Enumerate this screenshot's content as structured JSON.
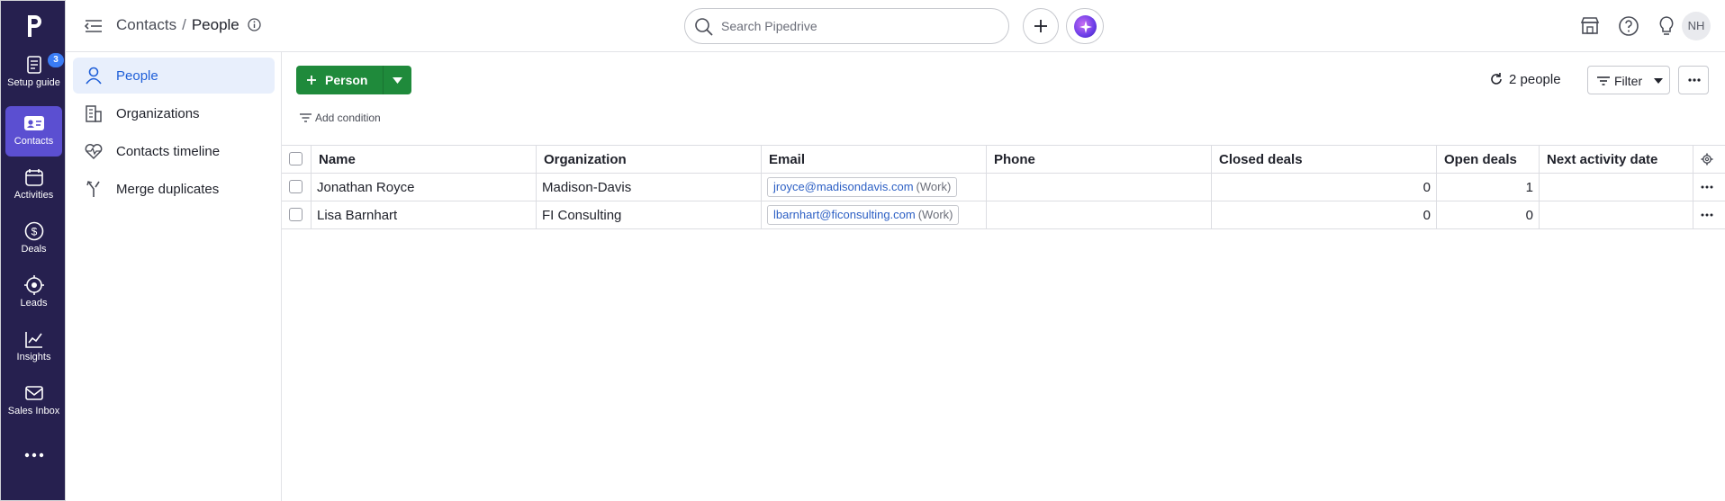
{
  "rail": {
    "logo": "P",
    "items": [
      {
        "label": "Setup guide",
        "icon": "checklist-icon",
        "badge": "3"
      },
      {
        "label": "Contacts",
        "icon": "contacts-card-icon"
      },
      {
        "label": "Activities",
        "icon": "calendar-icon"
      },
      {
        "label": "Deals",
        "icon": "dollar-icon"
      },
      {
        "label": "Leads",
        "icon": "target-icon"
      },
      {
        "label": "Insights",
        "icon": "chart-icon"
      },
      {
        "label": "Sales Inbox",
        "icon": "mail-icon"
      }
    ],
    "more": "more-icon"
  },
  "header": {
    "breadcrumb_parent": "Contacts",
    "breadcrumb_sep": "/",
    "breadcrumb_current": "People",
    "search_placeholder": "Search Pipedrive",
    "avatar_initials": "NH"
  },
  "sidenav": {
    "items": [
      {
        "label": "People",
        "icon": "person-icon",
        "active": true
      },
      {
        "label": "Organizations",
        "icon": "building-icon"
      },
      {
        "label": "Contacts timeline",
        "icon": "heart-pulse-icon"
      },
      {
        "label": "Merge duplicates",
        "icon": "merge-icon"
      }
    ]
  },
  "toolbar": {
    "add_person_label": "Person",
    "add_condition_label": "Add condition",
    "people_count": "2 people",
    "filter_label": "Filter"
  },
  "table": {
    "columns": [
      "Name",
      "Organization",
      "Email",
      "Phone",
      "Closed deals",
      "Open deals",
      "Next activity date"
    ],
    "rows": [
      {
        "name": "Jonathan Royce",
        "organization": "Madison-Davis",
        "email": "jroyce@madisondavis.com",
        "email_type": "(Work)",
        "phone": "",
        "closed_deals": "0",
        "open_deals": "1",
        "next_activity": ""
      },
      {
        "name": "Lisa Barnhart",
        "organization": "FI Consulting",
        "email": "lbarnhart@ficonsulting.com",
        "email_type": "(Work)",
        "phone": "",
        "closed_deals": "0",
        "open_deals": "0",
        "next_activity": ""
      }
    ]
  },
  "colors": {
    "rail_bg": "#26204f",
    "rail_active": "#5b4fd1",
    "primary_green": "#1f8a3b",
    "link_blue": "#2c5fc4",
    "nav_active_bg": "#e8effc"
  }
}
